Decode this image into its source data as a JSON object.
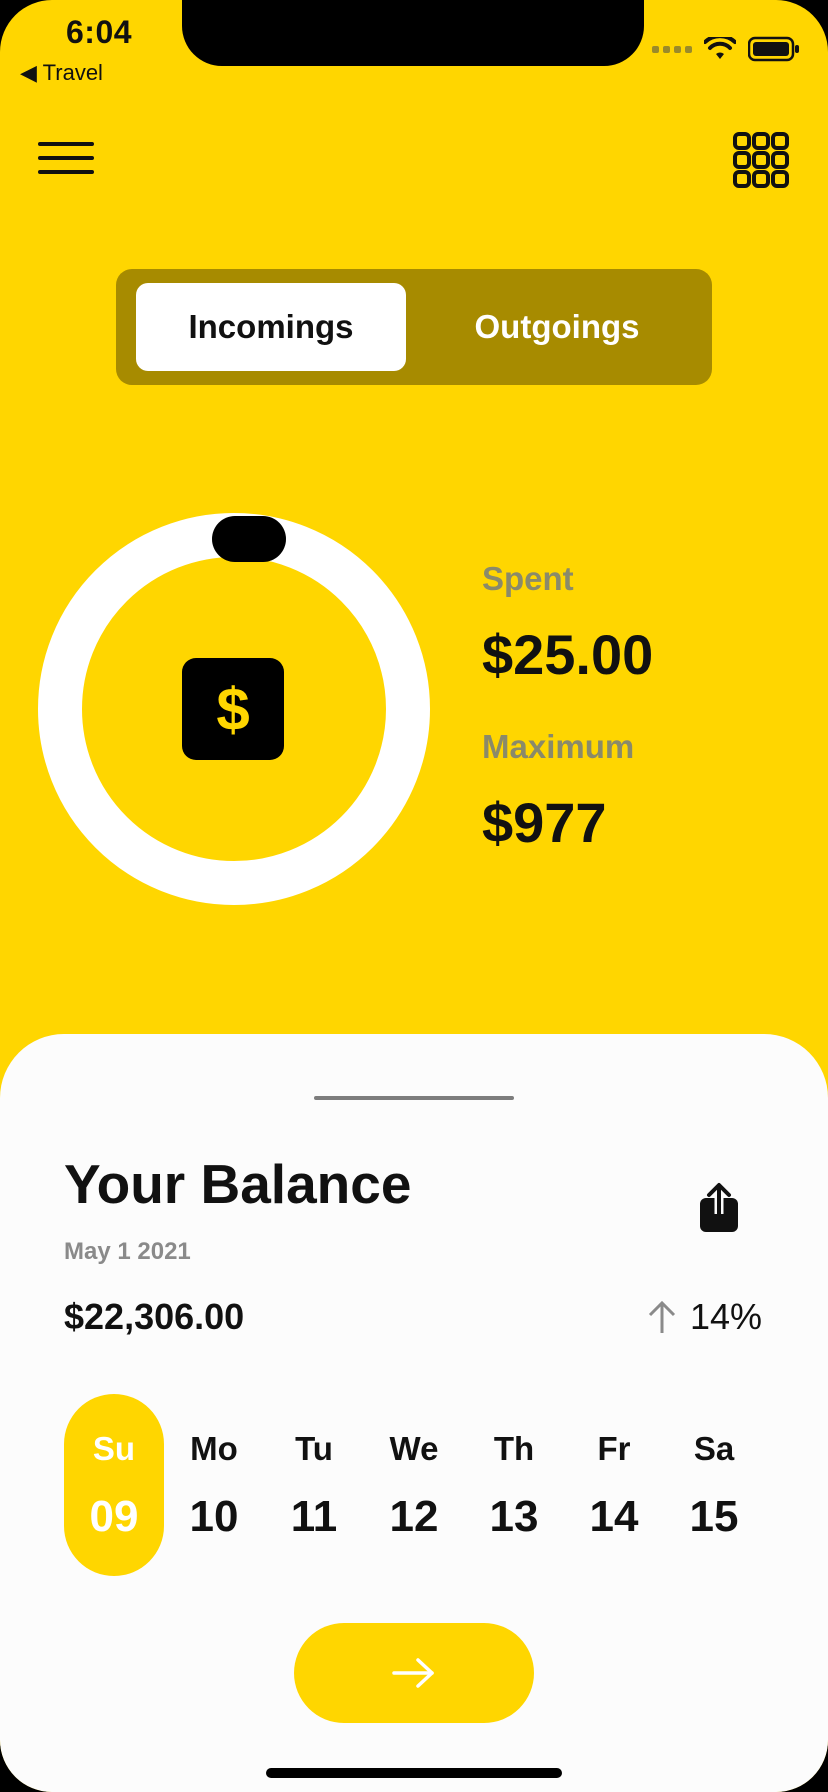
{
  "status_bar": {
    "time": "6:04",
    "back_app": "◀ Travel"
  },
  "tabs": [
    {
      "label": "Incomings",
      "active": true
    },
    {
      "label": "Outgoings",
      "active": false
    }
  ],
  "budget": {
    "spent_label": "Spent",
    "spent_value": "$25.00",
    "max_label": "Maximum",
    "max_value": "$977",
    "currency_symbol": "$"
  },
  "sheet": {
    "title": "Your Balance",
    "date": "May 1 2021",
    "amount": "$22,306.00",
    "change_percent": "14%",
    "change_direction": "up"
  },
  "week": [
    {
      "day": "Su",
      "date": "09",
      "selected": true
    },
    {
      "day": "Mo",
      "date": "10",
      "selected": false
    },
    {
      "day": "Tu",
      "date": "11",
      "selected": false
    },
    {
      "day": "We",
      "date": "12",
      "selected": false
    },
    {
      "day": "Th",
      "date": "13",
      "selected": false
    },
    {
      "day": "Fr",
      "date": "14",
      "selected": false
    },
    {
      "day": "Sa",
      "date": "15",
      "selected": false
    }
  ],
  "colors": {
    "accent": "#FFD600",
    "tab_track": "#A78B00",
    "sheet_bg": "#FCFCFC",
    "text": "#111111",
    "muted": "#8A8A6A"
  },
  "icons": [
    "menu-icon",
    "grid-icon",
    "dollar-icon",
    "share-icon",
    "arrow-up-icon",
    "arrow-right-icon",
    "wifi-icon",
    "battery-icon"
  ]
}
